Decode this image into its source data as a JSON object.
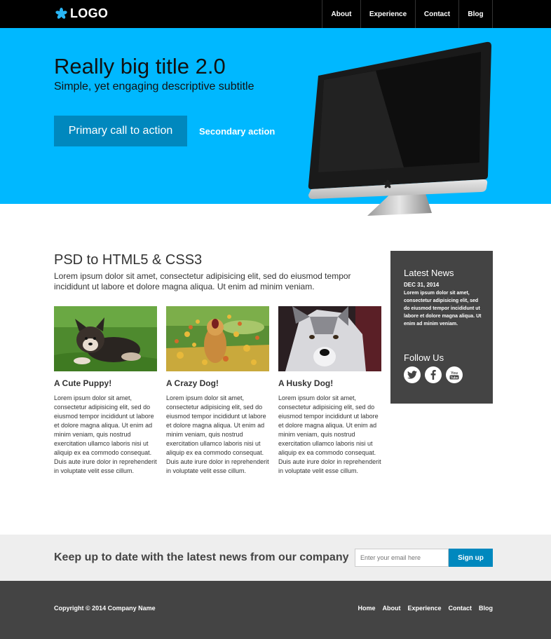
{
  "header": {
    "logo_text": "LOGO",
    "nav": [
      "About",
      "Experience",
      "Contact",
      "Blog"
    ]
  },
  "hero": {
    "title": "Really big title 2.0",
    "subtitle": "Simple, yet engaging descriptive subtitle",
    "primary_cta": "Primary call to action",
    "secondary_cta": "Secondary action"
  },
  "content": {
    "title": "PSD to HTML5 & CSS3",
    "intro": "Lorem ipsum dolor sit amet, consectetur adipisicing elit, sed do eiusmod tempor incididunt ut labore et dolore magna aliqua. Ut enim ad minim veniam.",
    "cards": [
      {
        "title": "A Cute Puppy!",
        "text": "Lorem ipsum dolor sit amet, consectetur adipisicing elit, sed do eiusmod tempor incididunt ut labore et dolore magna aliqua. Ut enim ad minim veniam, quis nostrud exercitation ullamco laboris nisi ut aliquip ex ea commodo consequat. Duis aute irure dolor in reprehenderit in voluptate velit esse cillum."
      },
      {
        "title": "A Crazy Dog!",
        "text": "Lorem ipsum dolor sit amet, consectetur adipisicing elit, sed do eiusmod tempor incididunt ut labore et dolore magna aliqua. Ut enim ad minim veniam, quis nostrud exercitation ullamco laboris nisi ut aliquip ex ea commodo consequat. Duis aute irure dolor in reprehenderit in voluptate velit esse cillum."
      },
      {
        "title": "A Husky Dog!",
        "text": "Lorem ipsum dolor sit amet, consectetur adipisicing elit, sed do eiusmod tempor incididunt ut labore et dolore magna aliqua. Ut enim ad minim veniam, quis nostrud exercitation ullamco laboris nisi ut aliquip ex ea commodo consequat. Duis aute irure dolor in reprehenderit in voluptate velit esse cillum."
      }
    ]
  },
  "sidebar": {
    "news_title": "Latest News",
    "news_date": "DEC 31, 2014",
    "news_text": "Lorem ipsum dolor sit amet, consectetur adipisicing elit, sed do eiusmod tempor incididunt ut labore et dolore magna aliqua. Ut enim ad minim veniam.",
    "follow_title": "Follow Us",
    "social_icons": [
      "twitter-icon",
      "facebook-icon",
      "youtube-icon"
    ],
    "youtube_label": "You Tube"
  },
  "newsletter": {
    "text": "Keep up to date with the latest news from our company",
    "placeholder": "Enter your email here",
    "button": "Sign up"
  },
  "footer": {
    "copyright": "Copyright © 2014 Company Name",
    "links": [
      "Home",
      "About",
      "Experience",
      "Contact",
      "Blog"
    ]
  },
  "colors": {
    "hero_bg": "#00b8ff",
    "accent": "#0088be",
    "dark": "#444444",
    "header_bg": "#000000"
  }
}
